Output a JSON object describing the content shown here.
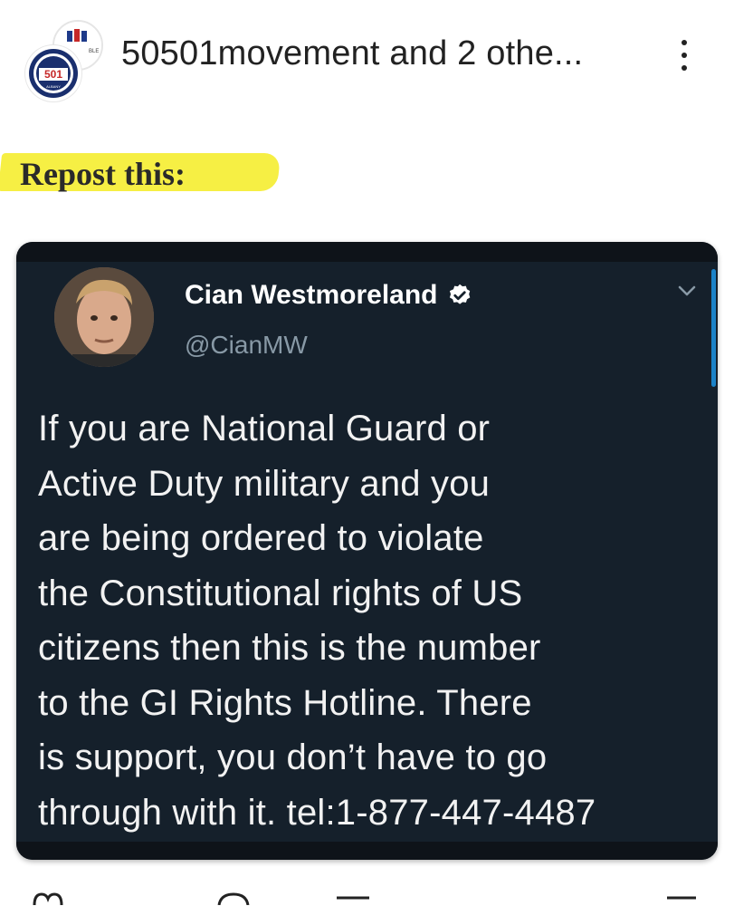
{
  "post": {
    "author_line": "50501movement and 2 othe...",
    "menu_icon": "more-vertical-icon",
    "logo_text": "501"
  },
  "caption": {
    "text": "Repost this:",
    "highlight_color": "#f6ee3a"
  },
  "tweet": {
    "name": "Cian Westmoreland",
    "handle": "@CianMW",
    "verified": true,
    "background_color": "#15202b",
    "body_lines": [
      "If you are National Guard or",
      "Active Duty military and you",
      "are being ordered to violate",
      "the Constitutional rights of US",
      "citizens then this is the number",
      "to the GI Rights Hotline. There",
      "is support, you don’t have to go",
      "through with it. tel:1-877-447-4487"
    ]
  },
  "actions": [
    "like-icon",
    "comment-icon",
    "repost-icon",
    "share-icon"
  ]
}
